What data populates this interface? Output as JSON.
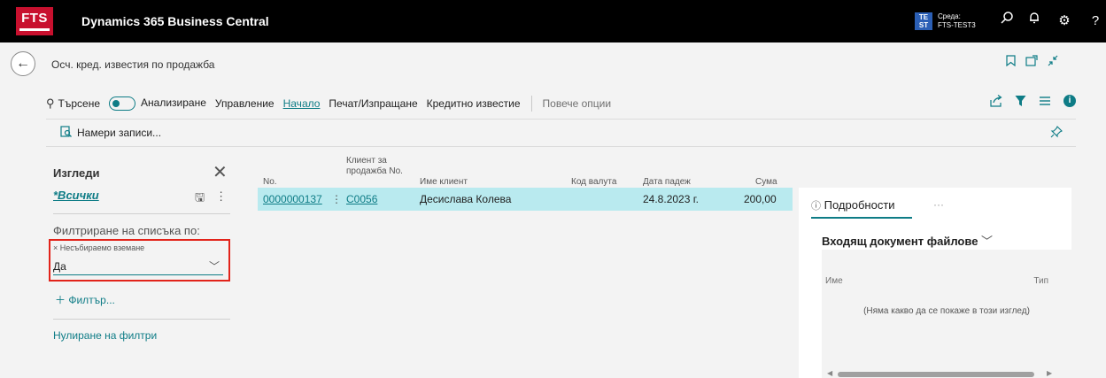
{
  "topbar": {
    "logo_text": "FTS",
    "app_title": "Dynamics 365 Business Central",
    "env_badge_line1": "TE",
    "env_badge_line2": "ST",
    "env_label": "Среда:",
    "env_name": "FTS-TEST3",
    "icons": [
      "search-icon",
      "bell-icon",
      "gear-icon",
      "help-icon"
    ]
  },
  "header": {
    "page_title": "Осч. кред. известия по продажба"
  },
  "actions": {
    "search": "Търсене",
    "analyze": "Анализиране",
    "manage": "Управление",
    "home": "Начало",
    "print_send": "Печат/Изпращане",
    "credit_memo": "Кредитно известие",
    "more_options": "Повече опции",
    "find_records": "Намери записи..."
  },
  "filter_pane": {
    "title": "Изгледи",
    "view_all": "*Всички",
    "filter_by": "Филтриране на списъка по:",
    "field_label": "Несъбираемо вземане",
    "field_value": "Да",
    "add_filter": "Филтър...",
    "reset_filters": "Нулиране на филтри"
  },
  "grid": {
    "columns": [
      "No.",
      "Клиент за",
      "продажба No.",
      "Име клиент",
      "Код валута",
      "Дата падеж",
      "Сума"
    ],
    "rows": [
      {
        "no": "0000000137",
        "customer_no": "C0056",
        "customer_name": "Десислава Колева",
        "currency": "",
        "due_date": "24.8.2023 г.",
        "amount": "200,00"
      }
    ]
  },
  "factbox": {
    "tab_details": "Подробности",
    "tab_more": "···",
    "section_title": "Входящ документ файлове",
    "col_name": "Име",
    "col_type": "Тип",
    "empty_message": "(Няма какво да се покаже в този изглед)"
  },
  "colors": {
    "accent": "#0e7c86",
    "selected_row": "#b9eaef",
    "highlight_box": "#e2231a",
    "topbar": "#000000",
    "logo": "#c8102e"
  }
}
